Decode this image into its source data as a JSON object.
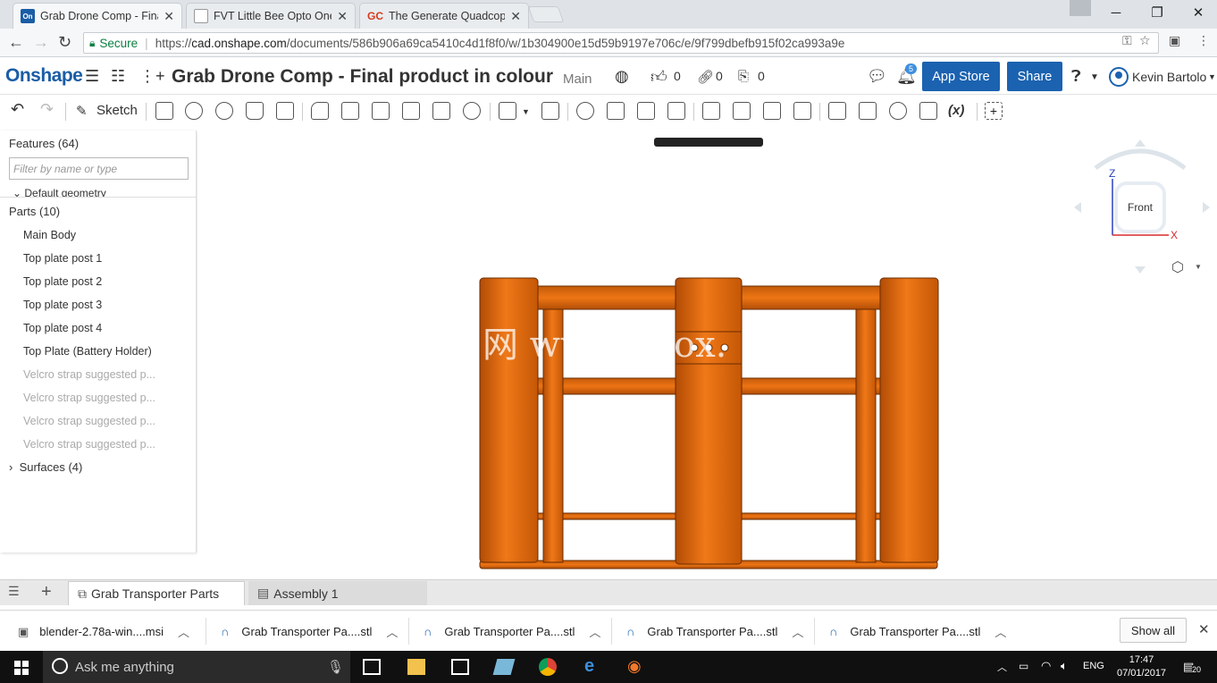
{
  "browser": {
    "tabs": [
      {
        "favicon": "On",
        "title": "Grab Drone Comp - Final",
        "active": true
      },
      {
        "favicon": "",
        "title": "FVT Little Bee Opto OneS",
        "active": false
      },
      {
        "favicon": "GC",
        "title": "The Generate Quadcopter",
        "active": false
      }
    ],
    "secure_label": "Secure",
    "url_scheme": "https://",
    "url_host": "cad.onshape.com",
    "url_path": "/documents/586b906a69ca5410c4d1f8f0/w/1b304900e15d59b9197e706c/e/9f799dbefb915f02ca993a9e"
  },
  "onshape": {
    "logo": "Onshape",
    "document_title": "Grab Drone Comp - Final product in colour",
    "workspace": "Main",
    "likes": "0",
    "links": "0",
    "copies": "0",
    "notifications": "5",
    "app_store_label": "App Store",
    "share_label": "Share",
    "user_name": "Kevin Bartolo"
  },
  "toolbar": {
    "sketch_label": "Sketch",
    "variable_label": "(x)"
  },
  "features": {
    "header": "Features (64)",
    "filter_placeholder": "Filter by name or type",
    "default_geometry": "Default geometry",
    "parts_header": "Parts (10)",
    "parts": [
      {
        "name": "Main Body",
        "hidden": false
      },
      {
        "name": "Top plate post 1",
        "hidden": false
      },
      {
        "name": "Top plate post 2",
        "hidden": false
      },
      {
        "name": "Top plate post 3",
        "hidden": false
      },
      {
        "name": "Top plate post 4",
        "hidden": false
      },
      {
        "name": "Top Plate (Battery Holder)",
        "hidden": false
      },
      {
        "name": "Velcro strap suggested p...",
        "hidden": true
      },
      {
        "name": "Velcro strap suggested p...",
        "hidden": true
      },
      {
        "name": "Velcro strap suggested p...",
        "hidden": true
      },
      {
        "name": "Velcro strap suggested p...",
        "hidden": true
      }
    ],
    "surfaces": "Surfaces (4)"
  },
  "view_cube": {
    "face": "Front",
    "axis_z": "Z",
    "axis_x": "X"
  },
  "watermark": "网 www.    mox.",
  "bottom_tabs": [
    {
      "label": "Grab Transporter Parts",
      "active": true
    },
    {
      "label": "Assembly 1",
      "active": false
    }
  ],
  "downloads": {
    "items": [
      "blender-2.78a-win....msi",
      "Grab Transporter Pa....stl",
      "Grab Transporter Pa....stl",
      "Grab Transporter Pa....stl",
      "Grab Transporter Pa....stl"
    ],
    "show_all_label": "Show all"
  },
  "taskbar": {
    "search_placeholder": "Ask me anything",
    "language": "ENG",
    "time": "17:47",
    "date": "07/01/2017",
    "notification_count": "20"
  },
  "colors": {
    "accent": "#1b62b0",
    "model_orange": "#e0670f",
    "model_edge": "#7a3200"
  }
}
